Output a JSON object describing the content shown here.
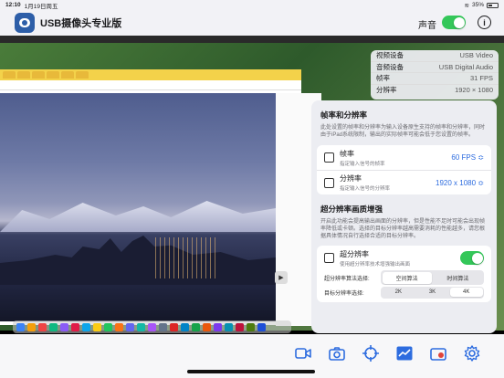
{
  "status": {
    "time": "12:10",
    "date": "1月19日周五",
    "battery": "35%"
  },
  "header": {
    "app_title": "USB摄像头专业版",
    "sound_label": "声音",
    "sound_on": true,
    "info_symbol": "i"
  },
  "video_info": {
    "rows": [
      {
        "label": "视频设备",
        "value": "USB Video"
      },
      {
        "label": "音频设备",
        "value": "USB Digital Audio"
      },
      {
        "label": "帧率",
        "value": "31 FPS"
      },
      {
        "label": "分辨率",
        "value": "1920 × 1080"
      }
    ]
  },
  "settings": {
    "framerate_section": {
      "title": "帧率和分辨率",
      "description": "此处设置的帧率和分辨率为输入设备原生支持的帧率和分辨率，同时由于iPad系统限制，输出的实际帧率可能会低于您设置的帧率。",
      "rows": [
        {
          "title": "帧率",
          "subtitle": "指定输入信号的帧率",
          "value": "60 FPS ≎"
        },
        {
          "title": "分辨率",
          "subtitle": "指定输入信号的分辨率",
          "value": "1920 x 1080 ≎"
        }
      ]
    },
    "superres_section": {
      "title": "超分辨率画质增强",
      "description": "开启此功能会提高输出画面的分辨率，但是性能不足时可能会出现帧率降低或卡顿。选择的目标分辨率越高需要消耗的性能越多，请您根据具体情况自行选择合适的目标分辨率。",
      "toggle_title": "超分辨率",
      "toggle_subtitle": "使用超分辨率技术增强输出画面",
      "toggle_on": true,
      "algorithm_label": "超分辨率算法选择:",
      "algorithm_options": [
        "空间算法",
        "时间算法"
      ],
      "algorithm_selected": 0,
      "target_label": "目标分辨率选择:",
      "target_options": [
        "2K",
        "3K",
        "4K"
      ],
      "target_selected": 2
    }
  },
  "toolbar": {
    "icons": [
      "video-camera-icon",
      "camera-icon",
      "crosshair-icon",
      "chart-icon",
      "record-icon",
      "gear-icon"
    ]
  },
  "colors": {
    "accent": "#2d6cdf",
    "toggle_on": "#34c759"
  }
}
